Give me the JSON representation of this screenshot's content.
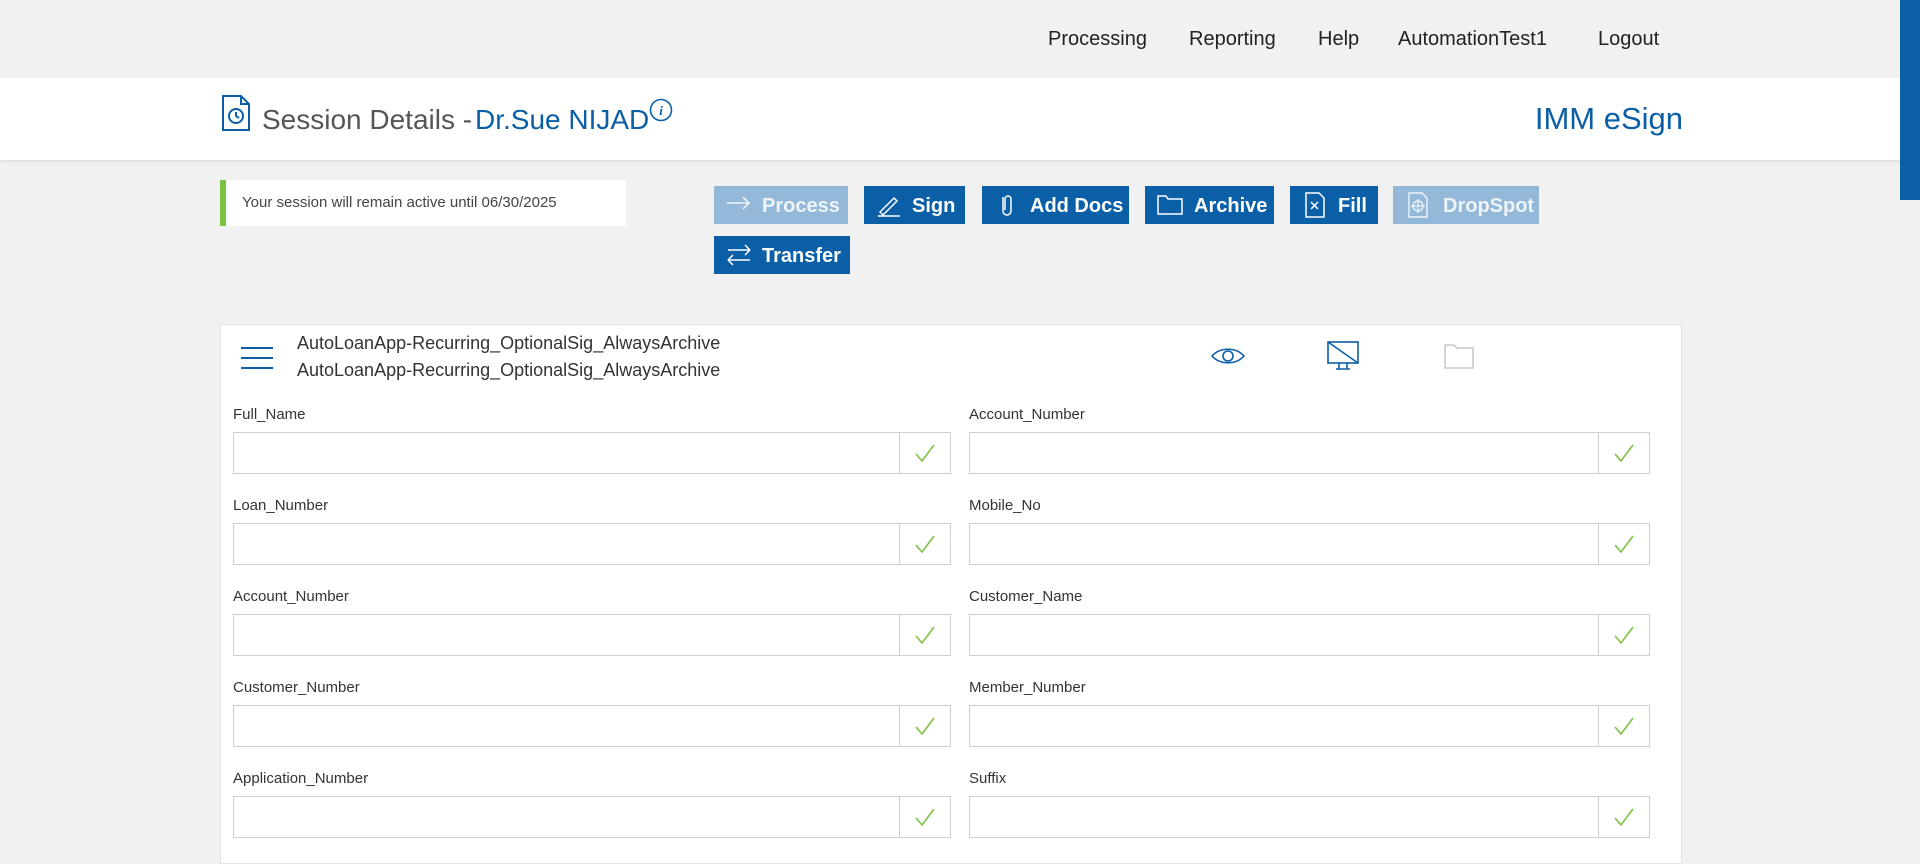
{
  "nav": {
    "items": [
      "Processing",
      "Reporting",
      "Help",
      "AutomationTest1",
      "Logout"
    ]
  },
  "header": {
    "title": "Session Details -",
    "name": "Dr.Sue NIJAD",
    "brand": "IMM eSign"
  },
  "notice": {
    "text": "Your session will remain active until 06/30/2025"
  },
  "actions": [
    {
      "label": "Process",
      "icon": "arrow-right-icon",
      "enabled": false
    },
    {
      "label": "Sign",
      "icon": "pen-icon",
      "enabled": true
    },
    {
      "label": "Add Docs",
      "icon": "paperclip-icon",
      "enabled": true
    },
    {
      "label": "Archive",
      "icon": "folder-icon",
      "enabled": true
    },
    {
      "label": "Fill",
      "icon": "fill-document-icon",
      "enabled": true
    },
    {
      "label": "DropSpot",
      "icon": "crosshair-icon",
      "enabled": false
    },
    {
      "label": "Transfer",
      "icon": "transfer-arrows-icon",
      "enabled": true
    }
  ],
  "document": {
    "name_line1": "AutoLoanApp-Recurring_OptionalSig_AlwaysArchive",
    "name_line2": "AutoLoanApp-Recurring_OptionalSig_AlwaysArchive"
  },
  "fields": [
    {
      "label": "Full_Name",
      "value": ""
    },
    {
      "label": "Account_Number",
      "value": ""
    },
    {
      "label": "Loan_Number",
      "value": ""
    },
    {
      "label": "Mobile_No",
      "value": ""
    },
    {
      "label": "Account_Number",
      "value": ""
    },
    {
      "label": "Customer_Name",
      "value": ""
    },
    {
      "label": "Customer_Number",
      "value": ""
    },
    {
      "label": "Member_Number",
      "value": ""
    },
    {
      "label": "Application_Number",
      "value": ""
    },
    {
      "label": "Suffix",
      "value": ""
    }
  ],
  "colors": {
    "primary": "#0a5fa6",
    "disabled": "#93b8d8",
    "success": "#7dc242"
  }
}
